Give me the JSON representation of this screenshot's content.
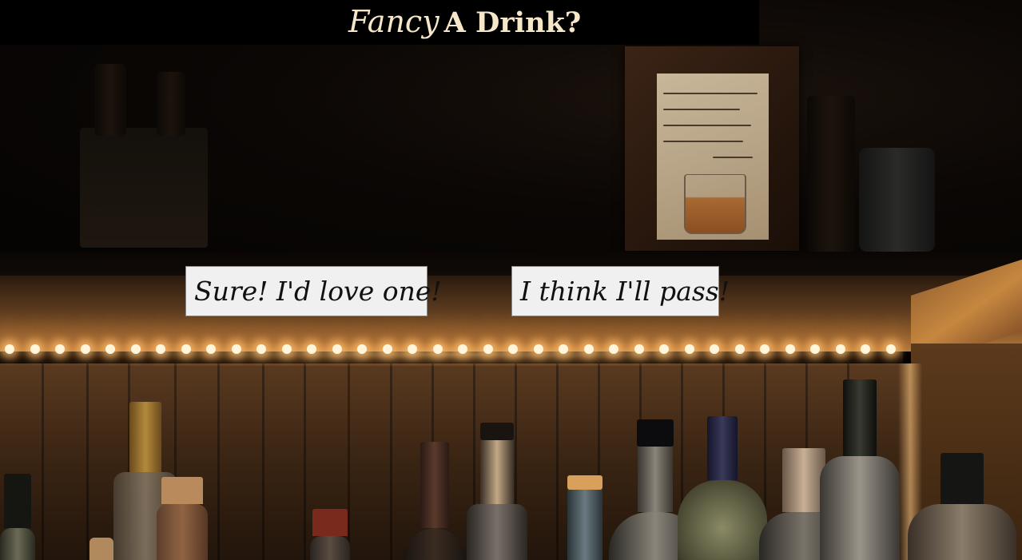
{
  "header": {
    "title_fancy": "Fancy",
    "title_rest": "A Drink?"
  },
  "choices": {
    "yes_label": "Sure! I'd love one!",
    "no_label": "I think I'll pass!"
  },
  "colors": {
    "title": "#f6e7c8",
    "button_bg": "#f0f0f0",
    "button_text": "#111111",
    "light_glow": "#ffbe6e"
  }
}
